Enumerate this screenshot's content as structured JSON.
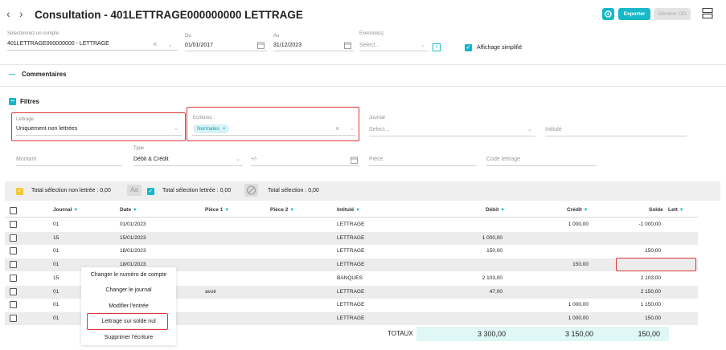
{
  "header": {
    "back_icon": "chevron-left-icon",
    "forward_icon": "chevron-right-icon",
    "title": "Consultation - 401LETTRAGE000000000 LETTRAGE",
    "export_label": "Exporter",
    "generate_label": "Générer OD",
    "accent": "#16b8c9"
  },
  "filters_top": {
    "account_label": "Sélectionnez un compte",
    "account_value": "401LETTRAGE000000000 - LETTRAGE",
    "from_label": "Du",
    "from_value": "01/01/2017",
    "to_label": "Au",
    "to_value": "31/12/2023",
    "exercise_label": "Exercice(s)",
    "exercise_placeholder": "Select...",
    "simplified_label": "Affichage simplifié",
    "clear_glyph": "×",
    "info_glyph": "i"
  },
  "comments": {
    "toggle": "—",
    "label": "Commentaires"
  },
  "filters": {
    "toggle": "−",
    "label": "Filtres",
    "lettrage_label": "Lettrage",
    "lettrage_value": "Uniquement non lettrées",
    "ecritures_label": "Ecritures :",
    "ecritures_chip": "Normales",
    "journal_label": "Journal",
    "journal_placeholder": "Select...",
    "intitule_placeholder": "Intitulé",
    "montant_placeholder": "Montant",
    "type_label": "Type",
    "type_value": "Débit & Crédit",
    "plusminus_placeholder": "+/-",
    "piece_placeholder": "Pièce",
    "code_lettrage_placeholder": "Code lettrage"
  },
  "selection_bar": {
    "non_lettree": "Total sélection non lettrée : 0,00",
    "aa_label": "Aa",
    "lettree": "Total sélection lettrée : 0,00",
    "total": "Total sélection : 0,00"
  },
  "table": {
    "sort_glyph": "▼",
    "headers": {
      "journal": "Journal",
      "date": "Date",
      "piece1": "Pièce 1",
      "piece2": "Pièce 2",
      "intitule": "Intitulé",
      "debit": "Débit",
      "credit": "Crédit",
      "solde": "Solde",
      "lett": "Lett"
    },
    "rows": [
      {
        "journal": "01",
        "date": "01/01/2023",
        "piece1": "",
        "intitule": "LETTRAGE",
        "debit": "",
        "credit": "1 000,00",
        "solde": "-1 000,00"
      },
      {
        "journal": "15",
        "date": "15/01/2023",
        "piece1": "",
        "intitule": "LETTRAGE",
        "debit": "1 000,00",
        "credit": "",
        "solde": ""
      },
      {
        "journal": "01",
        "date": "18/01/2023",
        "piece1": "",
        "intitule": "LETTRAGE",
        "debit": "150,00",
        "credit": "",
        "solde": "150,00"
      },
      {
        "journal": "01",
        "date": "18/01/2023",
        "piece1": "",
        "intitule": "LETTRAGE",
        "debit": "",
        "credit": "150,00",
        "solde": ""
      },
      {
        "journal": "15",
        "date": "",
        "piece1": "",
        "intitule": "BANQUES",
        "debit": "2 103,00",
        "credit": "",
        "solde": "2 103,00"
      },
      {
        "journal": "01",
        "date": "",
        "piece1": "avoir",
        "intitule": "LETTRAGE",
        "debit": "47,00",
        "credit": "",
        "solde": "2 150,00"
      },
      {
        "journal": "01",
        "date": "",
        "piece1": "",
        "intitule": "LETTRAGE",
        "debit": "",
        "credit": "1 000,00",
        "solde": "1 150,00"
      },
      {
        "journal": "01",
        "date": "",
        "piece1": "",
        "intitule": "LETTRAGE",
        "debit": "",
        "credit": "1 000,00",
        "solde": "150,00"
      }
    ],
    "totals": {
      "label": "TOTAUX",
      "debit": "3 300,00",
      "credit": "3 150,00",
      "solde": "150,00"
    }
  },
  "context_menu": {
    "items": [
      "Changer le numéro de compte",
      "Changer le journal",
      "Modifier l'entrée",
      "Lettrage sur solde nul",
      "Supprimer l'écriture"
    ]
  }
}
